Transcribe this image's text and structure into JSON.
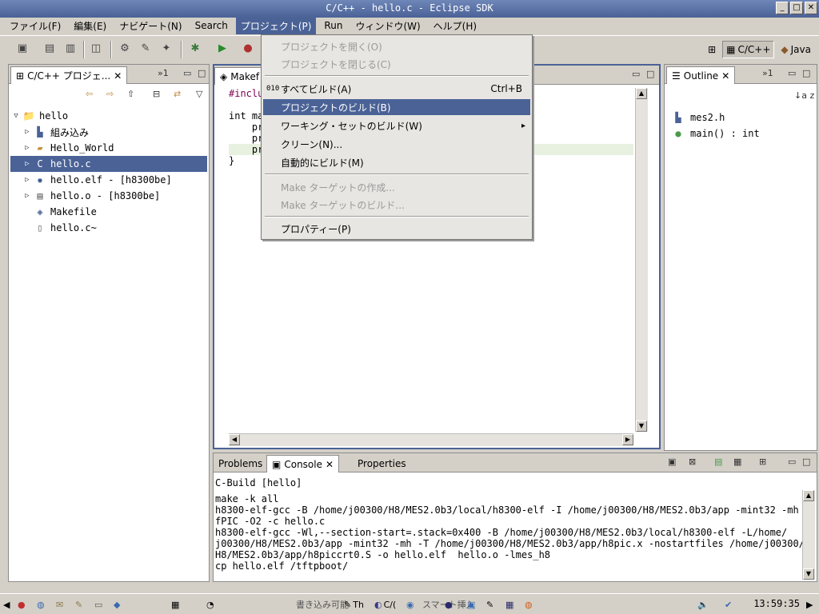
{
  "window": {
    "title": "C/C++ - hello.c - Eclipse SDK",
    "buttons": [
      "_",
      "□",
      "✕"
    ]
  },
  "menubar": {
    "items": [
      "ファイル(F)",
      "編集(E)",
      "ナビゲート(N)",
      "Search",
      "プロジェクト(P)",
      "Run",
      "ウィンドウ(W)",
      "ヘルプ(H)"
    ]
  },
  "perspectives": {
    "cpp": "C/C++",
    "java": "Java"
  },
  "project_explorer": {
    "tab_label": "C/C++ プロジェ...",
    "overflow": "»1",
    "items": [
      {
        "label": "hello",
        "icon": "project-icon",
        "twisty": "▽"
      },
      {
        "label": "組み込み",
        "icon": "includes-icon",
        "twisty": "▷"
      },
      {
        "label": "Hello_World",
        "icon": "folder-icon",
        "twisty": "▷"
      },
      {
        "label": "hello.c",
        "icon": "c-file-icon",
        "twisty": "▷"
      },
      {
        "label": "hello.elf - [h8300be]",
        "icon": "binary-icon",
        "twisty": "▷"
      },
      {
        "label": "hello.o - [h8300be]",
        "icon": "object-file-icon",
        "twisty": "▷"
      },
      {
        "label": "Makefile",
        "icon": "makefile-icon",
        "twisty": ""
      },
      {
        "label": "hello.c~",
        "icon": "text-file-icon",
        "twisty": ""
      }
    ]
  },
  "editor": {
    "tab_label": "Makef",
    "code_lines": [
      "#inclu",
      "",
      "int ma",
      "    pr",
      "    pr",
      "    pr",
      "}"
    ]
  },
  "outline": {
    "tab_label": "Outline",
    "overflow": "»1",
    "sort_label": "↓a z",
    "items": [
      "mes2.h",
      "main() : int"
    ]
  },
  "console": {
    "tabs": [
      "Problems",
      "Console",
      "Properties"
    ],
    "header": "C-Build [hello]",
    "lines": [
      "make -k all",
      "h8300-elf-gcc -B /home/j00300/H8/MES2.0b3/local/h8300-elf -I /home/j00300/H8/MES2.0b3/app -mint32 -mh -",
      "fPIC -O2 -c hello.c",
      "h8300-elf-gcc -Wl,--section-start=.stack=0x400 -B /home/j00300/H8/MES2.0b3/local/h8300-elf -L/home/",
      "j00300/H8/MES2.0b3/app -mint32 -mh -T /home/j00300/H8/MES2.0b3/app/h8pic.x -nostartfiles /home/j00300/",
      "H8/MES2.0b3/app/h8piccrt0.S -o hello.elf  hello.o -lmes_h8",
      "cp hello.elf /tftpboot/"
    ]
  },
  "dropdown": {
    "items": [
      {
        "label": "プロジェクトを開く(O)",
        "state": "disabled",
        "accel": "",
        "submenu": false
      },
      {
        "label": "プロジェクトを閉じる(C)",
        "state": "disabled",
        "accel": "",
        "submenu": false
      },
      {
        "label": "すべてビルド(A)",
        "state": "normal",
        "accel": "Ctrl+B",
        "submenu": false
      },
      {
        "label": "プロジェクトのビルド(B)",
        "state": "highlight",
        "accel": "",
        "submenu": false
      },
      {
        "label": "ワーキング・セットのビルド(W)",
        "state": "normal",
        "accel": "",
        "submenu": true
      },
      {
        "label": "クリーン(N)...",
        "state": "normal",
        "accel": "",
        "submenu": false
      },
      {
        "label": "自動的にビルド(M)",
        "state": "normal",
        "accel": "",
        "submenu": false
      },
      {
        "label": "Make ターゲットの作成...",
        "state": "disabled",
        "accel": "",
        "submenu": false
      },
      {
        "label": "Make ターゲットのビルド...",
        "state": "disabled",
        "accel": "",
        "submenu": false
      },
      {
        "label": "プロパティー(P)",
        "state": "normal",
        "accel": "",
        "submenu": false
      }
    ],
    "build_all_icon": "010"
  },
  "taskbar": {
    "status_partial_1": "書き込み可能",
    "status_partial_2": "スマート挿入",
    "tasks": [
      "Th",
      "C/("
    ],
    "clock": "13:59:35"
  }
}
